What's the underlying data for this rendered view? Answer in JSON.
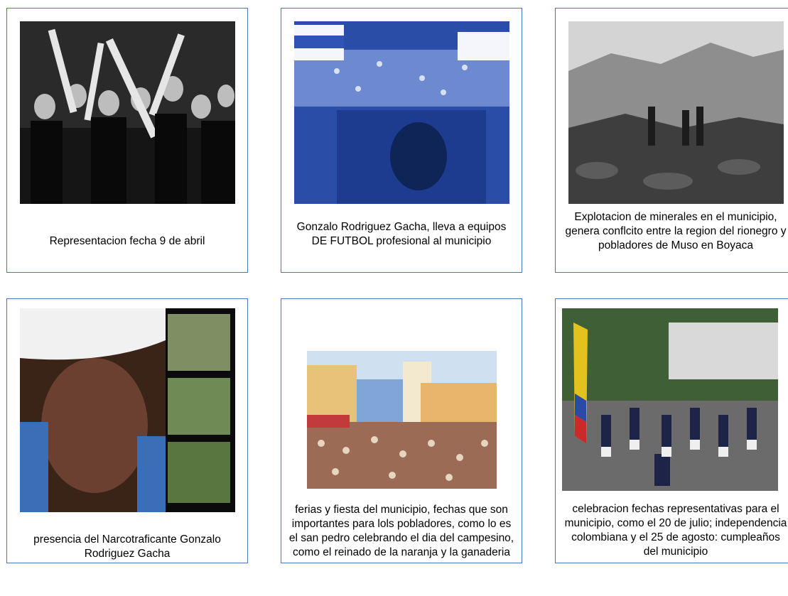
{
  "cards": [
    {
      "caption": "Representacion fecha 9 de abril"
    },
    {
      "caption": "Gonzalo Rodriguez Gacha, lleva a equipos DE FUTBOL profesional al municipio"
    },
    {
      "caption": "Explotacion de minerales en el municipio, genera conflcito entre la region del rionegro y pobladores de Muso en Boyaca"
    },
    {
      "caption": "presencia del Narcotraficante Gonzalo Rodriguez Gacha"
    },
    {
      "caption": "ferias y fiesta del municipio, fechas que son importantes para lols pobladores, como lo es el san pedro celebrando el dia del campesino, como el reinado de la naranja y la ganaderia"
    },
    {
      "caption": "celebracion fechas representativas para el municipio, como el 20 de julio; independencia colombiana y el 25 de agosto: cumpleaños del municipio"
    }
  ],
  "colors": {
    "border": "#4a74c4"
  }
}
